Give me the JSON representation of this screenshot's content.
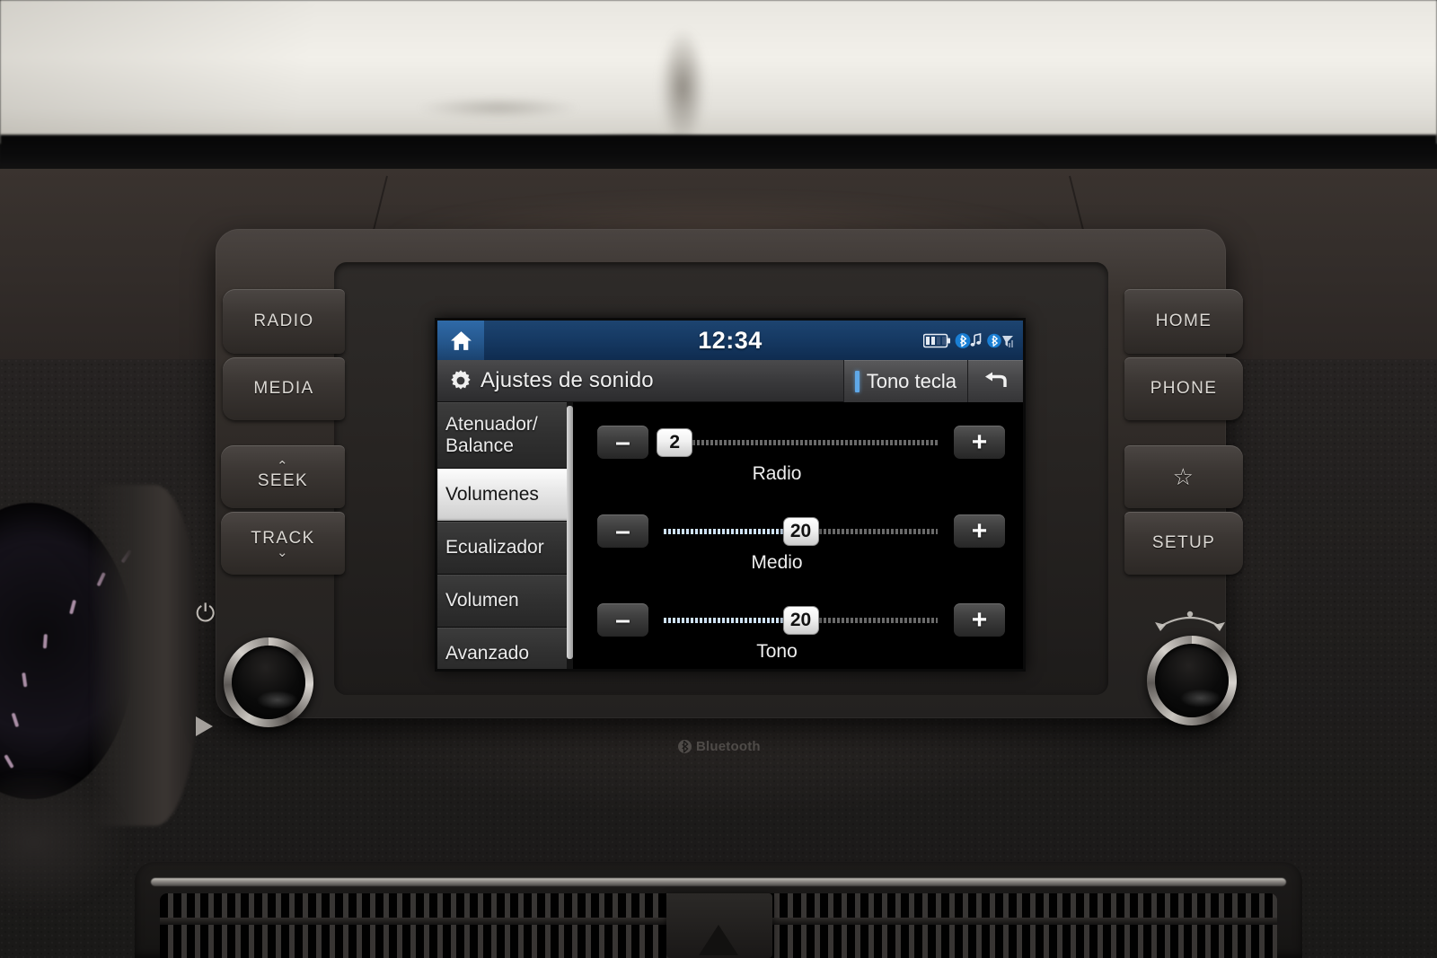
{
  "screen": {
    "status_bar": {
      "home_icon": "home-icon",
      "clock": "12:34",
      "icons": [
        "battery-icon",
        "bluetooth-audio-icon",
        "bluetooth-phone-signal-icon"
      ]
    },
    "title_bar": {
      "gear_icon": "gear-icon",
      "title": "Ajustes de sonido",
      "key_tone_label": "Tono tecla",
      "back_icon": "back-arrow-icon"
    },
    "sidebar": {
      "items": [
        {
          "label": "Atenuador/\nBalance",
          "active": false
        },
        {
          "label": "Volumenes",
          "active": true
        },
        {
          "label": "Ecualizador",
          "active": false
        },
        {
          "label": "Volumen",
          "active": false
        },
        {
          "label": "Avanzado",
          "active": false
        }
      ]
    },
    "sliders": [
      {
        "label": "Radio",
        "value": "2",
        "percent": 4,
        "minus": "–",
        "plus": "+"
      },
      {
        "label": "Medio",
        "value": "20",
        "percent": 50,
        "minus": "–",
        "plus": "+"
      },
      {
        "label": "Tono",
        "value": "20",
        "percent": 50,
        "minus": "–",
        "plus": "+"
      }
    ]
  },
  "hardware": {
    "left_buttons": [
      {
        "label": "RADIO",
        "chevron_top": "",
        "chevron_bottom": ""
      },
      {
        "label": "MEDIA",
        "chevron_top": "",
        "chevron_bottom": ""
      },
      {
        "label": "SEEK",
        "chevron_top": "⌃",
        "chevron_bottom": ""
      },
      {
        "label": "TRACK",
        "chevron_top": "",
        "chevron_bottom": "⌄"
      }
    ],
    "right_buttons": [
      {
        "label": "HOME",
        "icon": ""
      },
      {
        "label": "PHONE",
        "icon": ""
      },
      {
        "label": "",
        "icon": "☆"
      },
      {
        "label": "SETUP",
        "icon": ""
      }
    ],
    "left_knob": {
      "glyph": "⏻",
      "name": "power-volume-knob"
    },
    "right_knob": {
      "glyph": "tune-arrows-icon",
      "name": "tune-knob"
    },
    "bluetooth_badge": "Bluetooth"
  },
  "colors": {
    "accent_blue": "#5fa8e8",
    "status_bar_blue": "#1d4470",
    "bluetooth_blue": "#1a7fd4",
    "track_fill": "#cfe2f5",
    "track_empty": "#6a6a6a"
  }
}
